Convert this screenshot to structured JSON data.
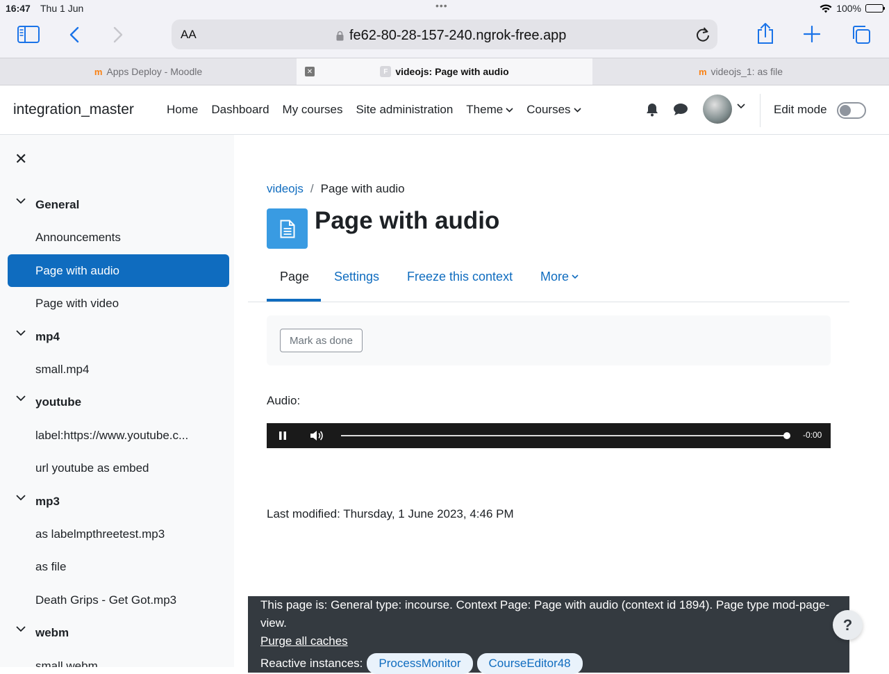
{
  "status_bar": {
    "time": "16:47",
    "date": "Thu 1 Jun",
    "battery": "100%"
  },
  "browser": {
    "text_size_label": "AA",
    "url": "fe62-80-28-157-240.ngrok-free.app",
    "tabs": [
      {
        "label": "Apps Deploy - Moodle",
        "active": false
      },
      {
        "label": "videojs: Page with audio",
        "active": true
      },
      {
        "label": "videojs_1: as file",
        "active": false
      }
    ]
  },
  "navbar": {
    "brand": "integration_master",
    "items": [
      "Home",
      "Dashboard",
      "My courses",
      "Site administration",
      "Theme",
      "Courses"
    ],
    "edit_mode_label": "Edit mode",
    "edit_mode_on": false
  },
  "drawer": {
    "items": [
      {
        "label": "General",
        "type": "section"
      },
      {
        "label": "Announcements",
        "type": "child"
      },
      {
        "label": "Page with audio",
        "type": "child",
        "active": true
      },
      {
        "label": "Page with video",
        "type": "child"
      },
      {
        "label": "mp4",
        "type": "section"
      },
      {
        "label": "small.mp4",
        "type": "child"
      },
      {
        "label": "youtube",
        "type": "section"
      },
      {
        "label": "label:https://www.youtube.c...",
        "type": "child"
      },
      {
        "label": "url youtube as embed",
        "type": "child"
      },
      {
        "label": "mp3",
        "type": "section"
      },
      {
        "label": "as labelmpthreetest.mp3",
        "type": "child"
      },
      {
        "label": "as file",
        "type": "child"
      },
      {
        "label": "Death Grips - Get Got.mp3",
        "type": "child"
      },
      {
        "label": "webm",
        "type": "section"
      },
      {
        "label": "small.webm",
        "type": "child"
      }
    ]
  },
  "main": {
    "breadcrumb": {
      "course": "videojs",
      "current": "Page with audio"
    },
    "title": "Page with audio",
    "tabs": [
      "Page",
      "Settings",
      "Freeze this context",
      "More"
    ],
    "active_tab": "Page",
    "mark_done_label": "Mark as done",
    "audio_label": "Audio:",
    "player": {
      "time": "-0:00",
      "progress": 1.0,
      "state": "playing"
    },
    "last_modified": "Last modified: Thursday, 1 June 2023, 4:46 PM"
  },
  "footer": {
    "page_info": "This page is: General type: incourse. Context Page: Page with audio (context id 1894). Page type mod-page-view.",
    "purge_label": "Purge all caches",
    "reactive_label": "Reactive instances:",
    "reactive_instances": [
      "ProcessMonitor",
      "CourseEditor48"
    ]
  },
  "help_button": "?",
  "colors": {
    "brand_blue": "#0f6cbf",
    "page_icon": "#399be2",
    "footer_bg": "#343a40"
  }
}
